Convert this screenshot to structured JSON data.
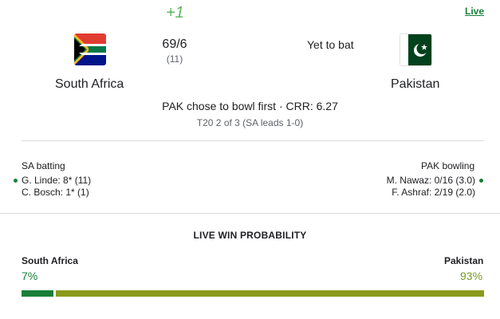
{
  "header": {
    "badge": "+1",
    "live_label": "Live"
  },
  "match": {
    "team_a": {
      "name": "South Africa",
      "score": "69/6",
      "overs": "(11)",
      "flag_icon": "south-africa-flag-icon"
    },
    "team_b": {
      "name": "Pakistan",
      "status": "Yet to bat",
      "flag_icon": "pakistan-flag-icon"
    },
    "summary": "PAK chose to bowl first · CRR: 6.27",
    "series": "T20 2 of 3 (SA leads 1-0)"
  },
  "batting": {
    "title": "SA batting",
    "players": [
      "G. Linde: 8* (11)",
      "C. Bosch: 1* (1)"
    ]
  },
  "bowling": {
    "title": "PAK bowling",
    "players": [
      "M. Nawaz: 0/16 (3.0)",
      "F. Ashraf: 2/19 (2.0)"
    ]
  },
  "win_probability": {
    "title": "LIVE WIN PROBABILITY",
    "team_a": {
      "name": "South Africa",
      "pct": "7%",
      "value": 7,
      "color": "#188038"
    },
    "team_b": {
      "name": "Pakistan",
      "pct": "93%",
      "value": 93,
      "color": "#8a9a1d"
    }
  }
}
